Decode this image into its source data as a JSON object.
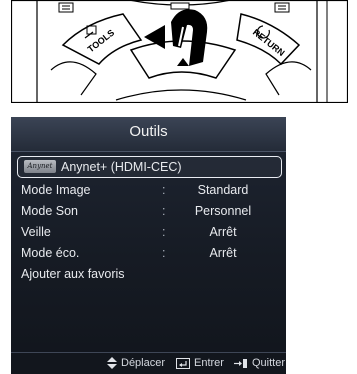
{
  "remote": {
    "buttons": {
      "tools_label": "TOOLS",
      "return_label": "RETURN"
    }
  },
  "menu": {
    "title": "Outils",
    "selected_item": {
      "logo_text": "Anynet",
      "label": "Anynet+ (HDMI-CEC)"
    },
    "items": [
      {
        "label": "Mode Image",
        "separator": ":",
        "value": "Standard"
      },
      {
        "label": "Mode Son",
        "separator": ":",
        "value": "Personnel"
      },
      {
        "label": "Veille",
        "separator": ":",
        "value": "Arrêt"
      },
      {
        "label": "Mode éco.",
        "separator": ":",
        "value": "Arrêt"
      },
      {
        "label": "Ajouter aux favoris"
      }
    ],
    "footer": {
      "move_label": "Déplacer",
      "enter_label": "Entrer",
      "quit_label": "Quitter"
    }
  }
}
